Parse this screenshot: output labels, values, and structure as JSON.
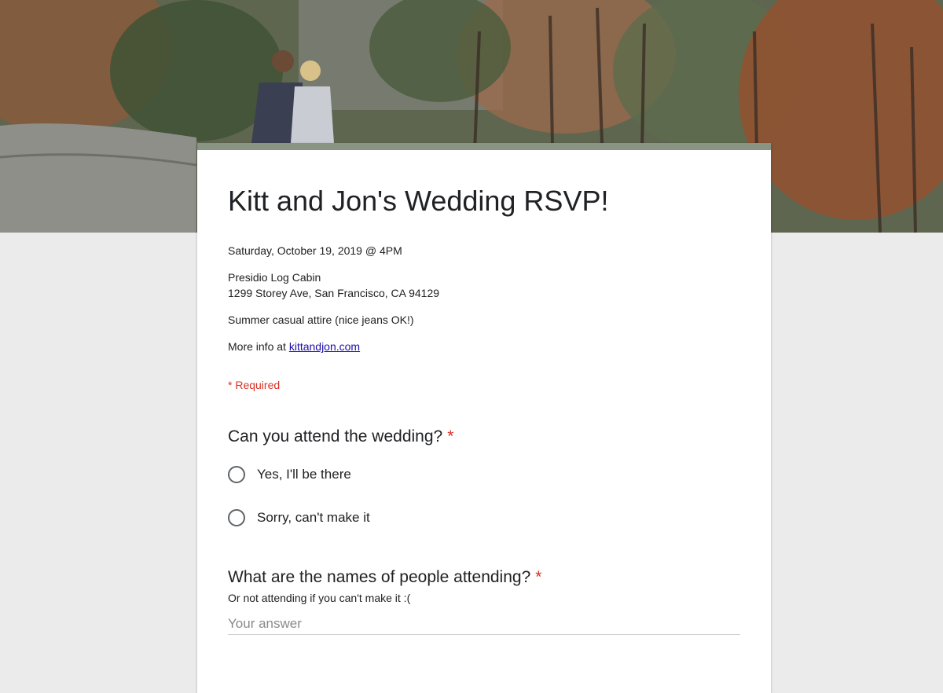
{
  "form": {
    "title": "Kitt and Jon's Wedding RSVP!",
    "date_line": "Saturday, October 19, 2019 @ 4PM",
    "venue": "Presidio Log Cabin",
    "address": "1299 Storey Ave, San Francisco, CA 94129",
    "attire": "Summer casual attire (nice jeans OK!)",
    "more_info_prefix": "More info at ",
    "more_info_link": "kittandjon.com",
    "required_note": "* Required"
  },
  "questions": [
    {
      "title": "Can you attend the wedding?",
      "required_mark": "*",
      "options": [
        "Yes, I'll be there",
        "Sorry, can't make it"
      ]
    },
    {
      "title": "What are the names of people attending?",
      "required_mark": "*",
      "helper": "Or not attending if you can't make it :(",
      "placeholder": "Your answer"
    }
  ],
  "colors": {
    "accent_bar": "#8a9482",
    "required": "#d93025",
    "page_background": "#ebebeb"
  },
  "icons": {
    "radio": "radio-unchecked-icon"
  }
}
